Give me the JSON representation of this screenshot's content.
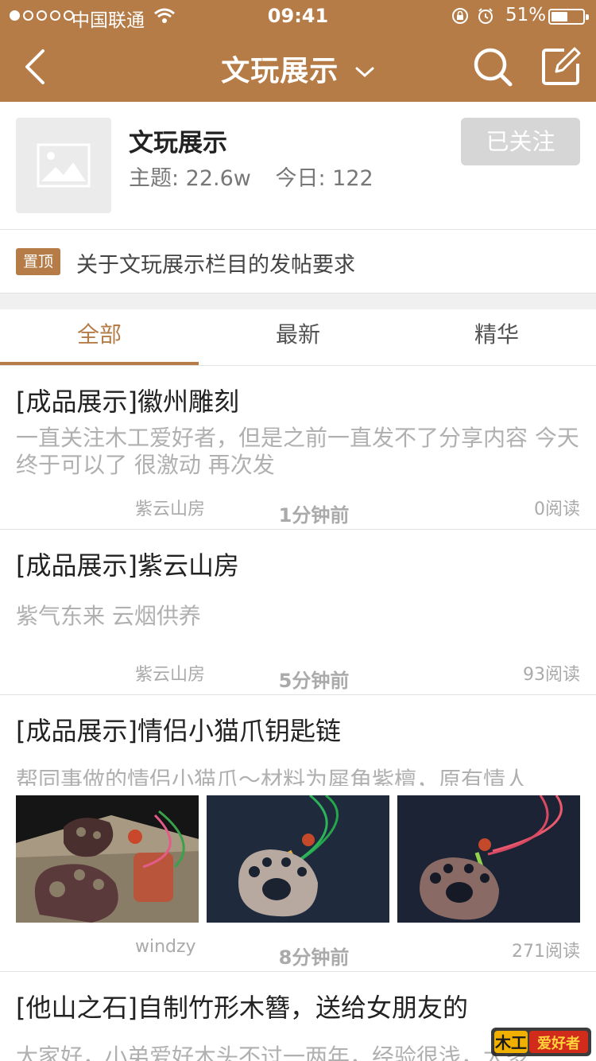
{
  "status_bar": {
    "carrier": "中国联通",
    "time": "09:41",
    "battery": "51%",
    "battery_level": 0.51
  },
  "nav": {
    "title": "文玩展示"
  },
  "forum": {
    "name": "文玩展示",
    "topics": "主题: 22.6w",
    "today": "今日: 122",
    "follow_label": "已关注"
  },
  "pinned": {
    "badge": "置顶",
    "text": "关于文玩展示栏目的发帖要求"
  },
  "tabs": [
    {
      "label": "全部",
      "active": true
    },
    {
      "label": "最新",
      "active": false
    },
    {
      "label": "精华",
      "active": false
    }
  ],
  "posts": [
    {
      "title": "[成品展示]徽州雕刻",
      "excerpt": "一直关注木工爱好者，但是之前一直发不了分享内容 今天终于可以了 很激动 再次发",
      "time": "1分钟前",
      "author": "紫云山房",
      "reads": "0阅读"
    },
    {
      "title": "[成品展示]紫云山房",
      "excerpt": "紫气东来  云烟供养",
      "time": "5分钟前",
      "author": "紫云山房",
      "reads": "93阅读"
    },
    {
      "title": "[成品展示]情侣小猫爪钥匙链",
      "excerpt": "帮同事做的情侣小猫爪～材料为犀角紫檀，原有情人",
      "time": "8分钟前",
      "author": "windzy",
      "reads": "271阅读"
    },
    {
      "title": "[他山之石]自制竹形木簪，送给女朋友的",
      "excerpt": "大家好，小弟爱好木头不过一两年，经验很浅，大多"
    }
  ],
  "watermark": "木工爱好者",
  "colors": {
    "brand": "#b57c47",
    "follow_bg": "#d6d6d6"
  }
}
